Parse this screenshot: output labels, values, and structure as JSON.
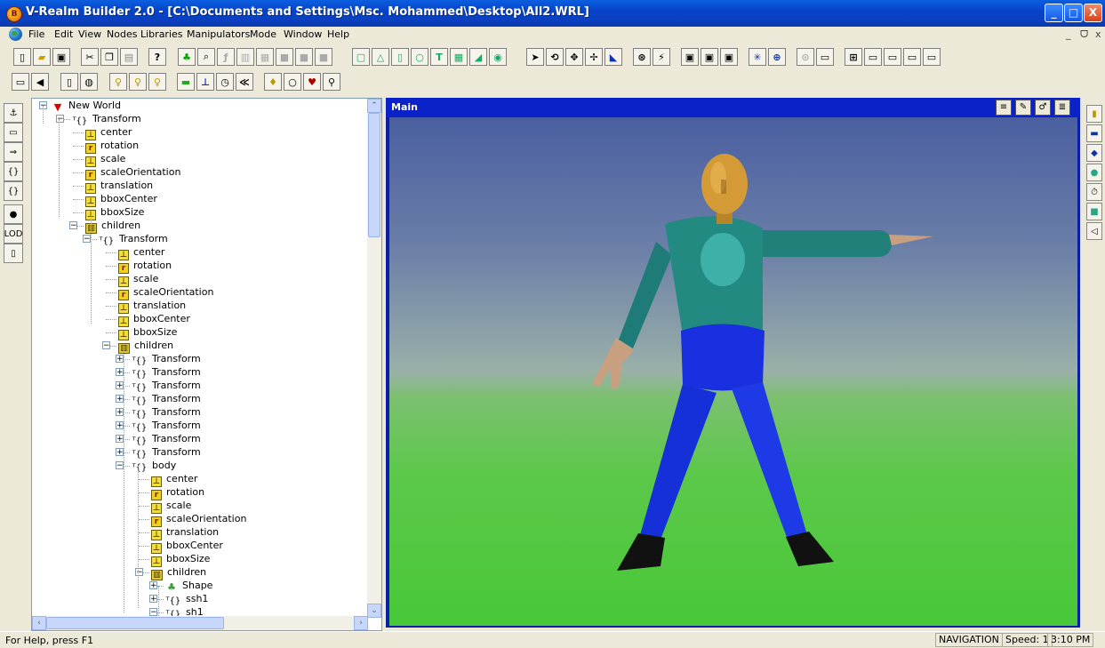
{
  "window": {
    "title": "V-Realm Builder 2.0 - [C:\\Documents and Settings\\Msc. Mohammed\\Desktop\\All2.WRL]",
    "app_icon_letter": "B",
    "minimize": "_",
    "maximize": "□",
    "close": "X"
  },
  "menu": {
    "items": [
      "File",
      "Edit",
      "View",
      "Nodes",
      "Libraries",
      "Manipulators",
      "Mode",
      "Window",
      "Help"
    ],
    "mdi_minimize": "_",
    "mdi_restore": "ᗜ",
    "mdi_close": "x"
  },
  "tree": {
    "root": "New World",
    "rows": [
      {
        "label": "Transform"
      },
      {
        "label": "center"
      },
      {
        "label": "rotation"
      },
      {
        "label": "scale"
      },
      {
        "label": "scaleOrientation"
      },
      {
        "label": "translation"
      },
      {
        "label": "bboxCenter"
      },
      {
        "label": "bboxSize"
      },
      {
        "label": "children"
      },
      {
        "label": "Transform"
      },
      {
        "label": "center"
      },
      {
        "label": "rotation"
      },
      {
        "label": "scale"
      },
      {
        "label": "scaleOrientation"
      },
      {
        "label": "translation"
      },
      {
        "label": "bboxCenter"
      },
      {
        "label": "bboxSize"
      },
      {
        "label": "children"
      },
      {
        "label": "Transform"
      },
      {
        "label": "Transform"
      },
      {
        "label": "Transform"
      },
      {
        "label": "Transform"
      },
      {
        "label": "Transform"
      },
      {
        "label": "Transform"
      },
      {
        "label": "Transform"
      },
      {
        "label": "Transform"
      },
      {
        "label": "body"
      },
      {
        "label": "center"
      },
      {
        "label": "rotation"
      },
      {
        "label": "scale"
      },
      {
        "label": "scaleOrientation"
      },
      {
        "label": "translation"
      },
      {
        "label": "bboxCenter"
      },
      {
        "label": "bboxSize"
      },
      {
        "label": "children"
      },
      {
        "label": "Shape"
      },
      {
        "label": "ssh1"
      },
      {
        "label": "sh1"
      }
    ]
  },
  "viewport": {
    "title": "Main"
  },
  "statusbar": {
    "help": "For Help, press F1",
    "mode": "NAVIGATION",
    "speed": "Speed: 1",
    "time": "3:10 PM"
  }
}
